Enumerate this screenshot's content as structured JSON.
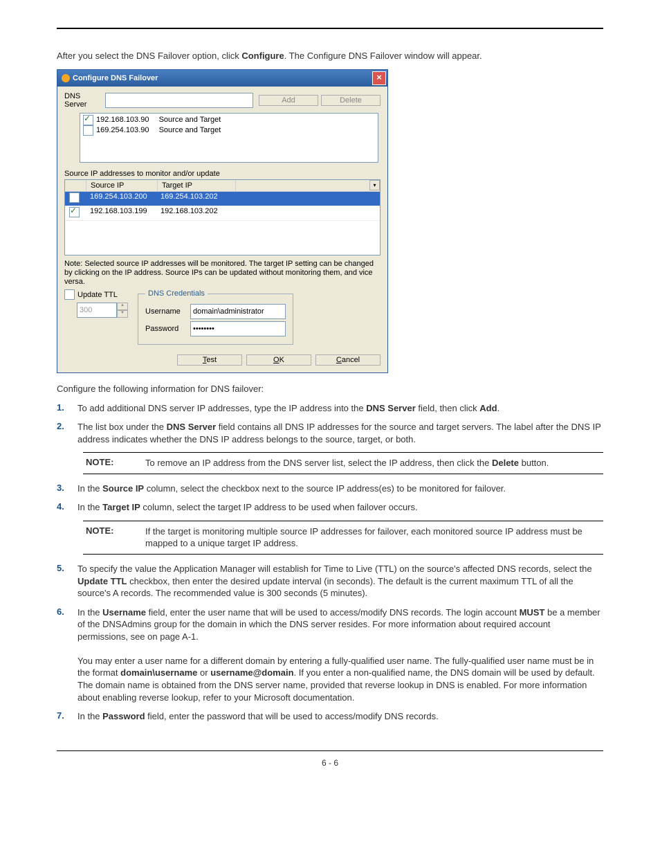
{
  "intro": {
    "text1": "After you select the DNS Failover option, click ",
    "bold1": "Configure",
    "text2": ". The Configure DNS Failover window will appear."
  },
  "dialog": {
    "title": "Configure DNS Failover",
    "dns_server_label": "DNS Server",
    "add_btn": "Add",
    "delete_btn": "Delete",
    "dns_list": [
      {
        "checked": true,
        "ip": "192.168.103.90",
        "desc": "Source and Target"
      },
      {
        "checked": false,
        "ip": "169.254.103.90",
        "desc": "Source and Target"
      }
    ],
    "source_label": "Source IP addresses to monitor and/or update",
    "headers": {
      "source": "Source IP",
      "target": "Target IP"
    },
    "ip_rows": [
      {
        "checked": true,
        "src": "169.254.103.200",
        "tgt": "169.254.103.202",
        "selected": true
      },
      {
        "checked": true,
        "src": "192.168.103.199",
        "tgt": "192.168.103.202",
        "selected": false
      }
    ],
    "note": "Note: Selected source IP addresses will be monitored.  The target IP setting can be changed by clicking on the IP address.  Source IPs can be updated without monitoring them, and vice versa.",
    "update_ttl_label": "Update TTL",
    "update_ttl_value": "300",
    "creds_legend": "DNS Credentials",
    "username_label": "Username",
    "username_value": "domain\\administrator",
    "password_label": "Password",
    "password_value": "********",
    "btn_test": "Test",
    "btn_ok": "OK",
    "btn_cancel": "Cancel"
  },
  "after_dialog": "Configure the following information for DNS failover:",
  "steps": {
    "s1a": "To add additional DNS server IP addresses, type the IP address into the ",
    "s1b": "DNS Server",
    "s1c": " field, then click ",
    "s1d": "Add",
    "s1e": ".",
    "s2a": "The list box under the ",
    "s2b": "DNS Server",
    "s2c": " field contains all DNS IP addresses for the source and target servers. The label after the DNS IP address indicates whether the DNS IP address belongs to the source, target, or both.",
    "s3a": "In the ",
    "s3b": "Source IP",
    "s3c": " column, select the checkbox next to the source IP address(es) to be monitored for failover.",
    "s4a": "In the ",
    "s4b": "Target IP",
    "s4c": " column, select the target IP address to be used when failover occurs.",
    "s5a": "To specify the value the Application Manager will establish for Time to Live (TTL) on the source's affected DNS records, select the ",
    "s5b": "Update TTL",
    "s5c": " checkbox, then enter the desired update interval (in seconds). The default is the current maximum TTL of all the source's A records. The recommended value is 300 seconds (5 minutes).",
    "s6a": "In the ",
    "s6b": "Username",
    "s6c": " field, enter the user name that will be used to access/modify DNS records. The login account ",
    "s6d": "MUST",
    "s6e": " be a member of the DNSAdmins group for the domain in which the DNS server resides. For more information about required account permissions, see ",
    "s6f": " on page A-1.",
    "s6para2_a": "You may enter a user name for a different domain by entering a fully-qualified user name. The fully-qualified user name must be in the format ",
    "s6para2_b": "domain\\username",
    "s6para2_c": " or ",
    "s6para2_d": "username@domain",
    "s6para2_e": ". If you enter a non-qualified name, the DNS domain will be used by default. The domain name is obtained from the DNS server name, provided that reverse lookup in DNS is enabled. For more information about enabling reverse lookup, refer to your Microsoft documentation.",
    "s7a": "In the ",
    "s7b": "Password",
    "s7c": " field, enter the password that will be used to access/modify DNS records."
  },
  "notes": {
    "label": "NOTE:",
    "n1a": "To remove an IP address from the DNS server list, select the IP address, then click the ",
    "n1b": "Delete",
    "n1c": " button.",
    "n2": "If the target is monitoring multiple source IP addresses for failover, each monitored source IP address must be mapped to a unique target IP address."
  },
  "page_number": "6 - 6"
}
